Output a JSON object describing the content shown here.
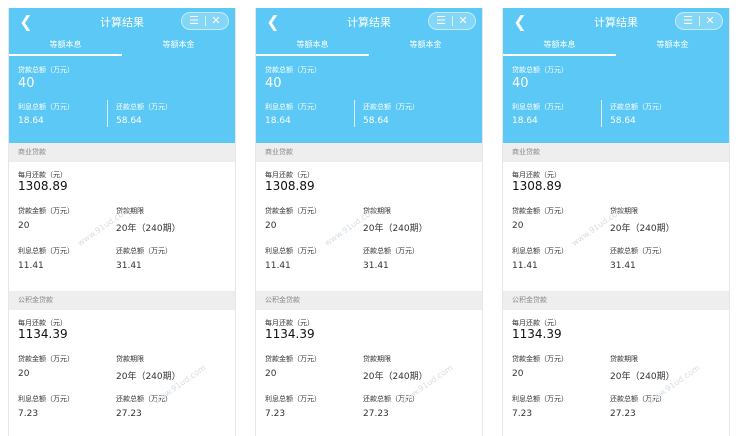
{
  "panels": [
    {
      "header": {
        "title": "计算结果",
        "back_icon": "chevron-left-icon",
        "menu_icon": "menu-icon",
        "close_icon": "close-icon"
      },
      "tabs": [
        {
          "label": "等额本息",
          "active": true
        },
        {
          "label": "等额本金",
          "active": false
        }
      ],
      "summary": {
        "total_label": "贷款总额（万元）",
        "total_value": "40",
        "interest_label": "利息总额（万元）",
        "interest_value": "18.64",
        "repay_label": "还款总额（万元）",
        "repay_value": "58.64"
      },
      "commercial": {
        "section_label": "商业贷款",
        "monthly_label": "每月还款（元）",
        "monthly_value": "1308.89",
        "amount_label": "贷款金额（万元）",
        "amount_value": "20",
        "term_label": "贷款期限",
        "term_value": "20年（240期）",
        "interest_label": "利息总额（万元）",
        "interest_value": "11.41",
        "repay_label": "还款总额（万元）",
        "repay_value": "31.41"
      },
      "fund": {
        "section_label": "公积金贷款",
        "monthly_label": "每月还款（元）",
        "monthly_value": "1134.39",
        "amount_label": "贷款金额（万元）",
        "amount_value": "20",
        "term_label": "贷款期限",
        "term_value": "20年（240期）",
        "interest_label": "利息总额（万元）",
        "interest_value": "7.23",
        "repay_label": "还款总额（万元）",
        "repay_value": "27.23"
      },
      "watermark": "www.91ud.com"
    },
    {
      "header": {
        "title": "计算结果",
        "back_icon": "chevron-left-icon",
        "menu_icon": "menu-icon",
        "close_icon": "close-icon"
      },
      "tabs": [
        {
          "label": "等额本息",
          "active": true
        },
        {
          "label": "等额本金",
          "active": false
        }
      ],
      "summary": {
        "total_label": "贷款总额（万元）",
        "total_value": "40",
        "interest_label": "利息总额（万元）",
        "interest_value": "18.64",
        "repay_label": "还款总额（万元）",
        "repay_value": "58.64"
      },
      "commercial": {
        "section_label": "商业贷款",
        "monthly_label": "每月还款（元）",
        "monthly_value": "1308.89",
        "amount_label": "贷款金额（万元）",
        "amount_value": "20",
        "term_label": "贷款期限",
        "term_value": "20年（240期）",
        "interest_label": "利息总额（万元）",
        "interest_value": "11.41",
        "repay_label": "还款总额（万元）",
        "repay_value": "31.41"
      },
      "fund": {
        "section_label": "公积金贷款",
        "monthly_label": "每月还款（元）",
        "monthly_value": "1134.39",
        "amount_label": "贷款金额（万元）",
        "amount_value": "20",
        "term_label": "贷款期限",
        "term_value": "20年（240期）",
        "interest_label": "利息总额（万元）",
        "interest_value": "7.23",
        "repay_label": "还款总额（万元）",
        "repay_value": "27.23"
      },
      "watermark": "www.91ud.com"
    },
    {
      "header": {
        "title": "计算结果",
        "back_icon": "chevron-left-icon",
        "menu_icon": "menu-icon",
        "close_icon": "close-icon"
      },
      "tabs": [
        {
          "label": "等额本息",
          "active": true
        },
        {
          "label": "等额本金",
          "active": false
        }
      ],
      "summary": {
        "total_label": "贷款总额（万元）",
        "total_value": "40",
        "interest_label": "利息总额（万元）",
        "interest_value": "18.64",
        "repay_label": "还款总额（万元）",
        "repay_value": "58.64"
      },
      "commercial": {
        "section_label": "商业贷款",
        "monthly_label": "每月还款（元）",
        "monthly_value": "1308.89",
        "amount_label": "贷款金额（万元）",
        "amount_value": "20",
        "term_label": "贷款期限",
        "term_value": "20年（240期）",
        "interest_label": "利息总额（万元）",
        "interest_value": "11.41",
        "repay_label": "还款总额（万元）",
        "repay_value": "31.41"
      },
      "fund": {
        "section_label": "公积金贷款",
        "monthly_label": "每月还款（元）",
        "monthly_value": "1134.39",
        "amount_label": "贷款金额（万元）",
        "amount_value": "20",
        "term_label": "贷款期限",
        "term_value": "20年（240期）",
        "interest_label": "利息总额（万元）",
        "interest_value": "7.23",
        "repay_label": "还款总额（万元）",
        "repay_value": "27.23"
      },
      "watermark": "www.91ud.com"
    }
  ],
  "colors": {
    "header_blue": "#5bc8f5",
    "section_gray": "#eeeeee"
  }
}
